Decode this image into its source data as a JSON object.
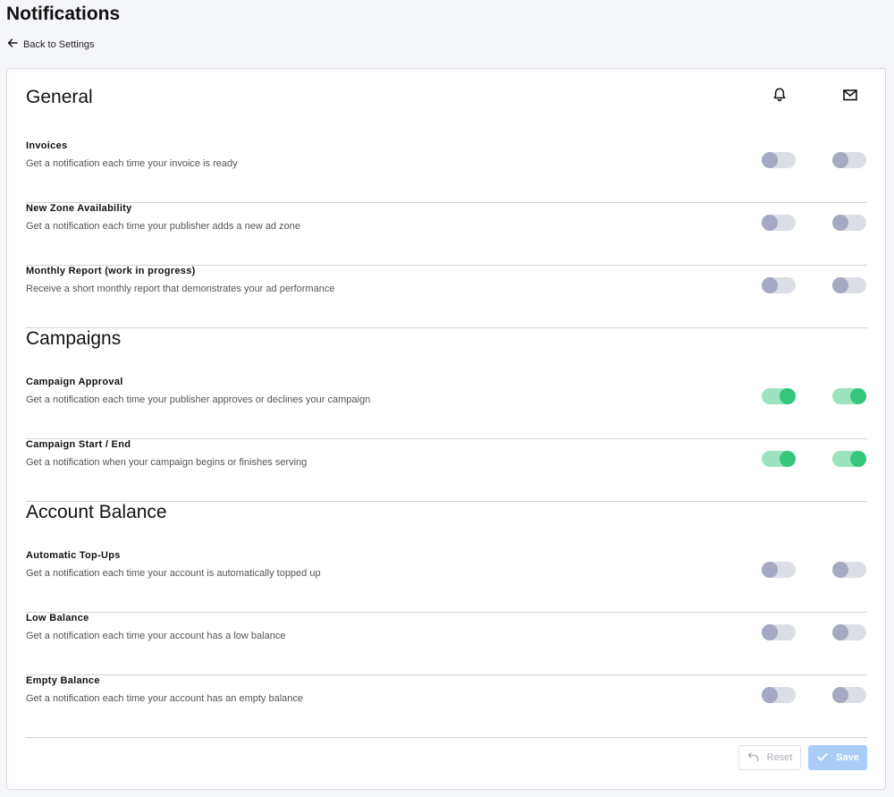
{
  "page": {
    "title": "Notifications",
    "back_label": "Back to Settings"
  },
  "columns": {
    "push_icon": "bell-icon",
    "email_icon": "envelope-icon"
  },
  "sections": [
    {
      "title": "General",
      "rows": [
        {
          "title": "Invoices",
          "description": "Get a notification each time your invoice is ready",
          "push": false,
          "email": false
        },
        {
          "title": "New Zone Availability",
          "description": "Get a notification each time your publisher adds a new ad zone",
          "push": false,
          "email": false
        },
        {
          "title": "Monthly Report (work in progress)",
          "description": "Receive a short monthly report that demonstrates your ad performance",
          "push": false,
          "email": false
        }
      ]
    },
    {
      "title": "Campaigns",
      "rows": [
        {
          "title": "Campaign Approval",
          "description": "Get a notification each time your publisher approves or declines your campaign",
          "push": true,
          "email": true
        },
        {
          "title": "Campaign Start / End",
          "description": "Get a notification when your campaign begins or finishes serving",
          "push": true,
          "email": true
        }
      ]
    },
    {
      "title": "Account Balance",
      "rows": [
        {
          "title": "Automatic Top-Ups",
          "description": "Get a notification each time your account is automatically topped up",
          "push": false,
          "email": false
        },
        {
          "title": "Low Balance",
          "description": "Get a notification each time your account has a low balance",
          "push": false,
          "email": false
        },
        {
          "title": "Empty Balance",
          "description": "Get a notification each time your account has an empty balance",
          "push": false,
          "email": false
        }
      ]
    }
  ],
  "actions": {
    "reset_label": "Reset",
    "save_label": "Save",
    "reset_icon": "undo-icon",
    "save_icon": "check-icon"
  },
  "colors": {
    "toggle_on_track": "#9be4bf",
    "toggle_on_knob": "#34c77b",
    "toggle_off_track": "#dcdee5",
    "toggle_off_knob": "#a5a9c1",
    "save_button": "#a9cdf7"
  }
}
